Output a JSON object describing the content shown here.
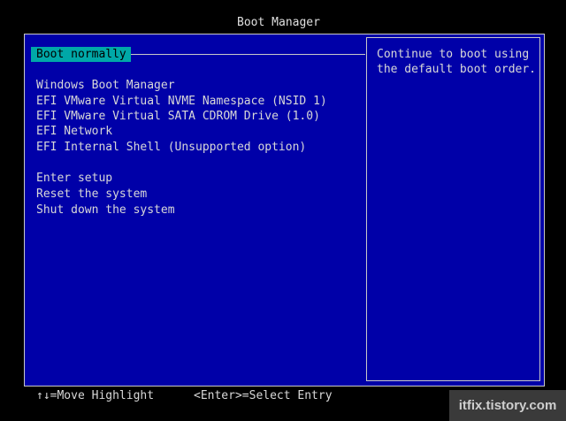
{
  "title": "Boot Manager",
  "menu": {
    "selected": "Boot normally",
    "boot_entries": [
      "Windows Boot Manager",
      "EFI VMware Virtual NVME Namespace (NSID 1)",
      "EFI VMware Virtual SATA CDROM Drive (1.0)",
      "EFI Network",
      "EFI Internal Shell (Unsupported option)"
    ],
    "actions": [
      "Enter setup",
      "Reset the system",
      "Shut down the system"
    ]
  },
  "help": {
    "text": "Continue to boot using\nthe default boot order."
  },
  "footer": {
    "move_hint": "↑↓=Move Highlight",
    "select_hint": "<Enter>=Select Entry"
  },
  "watermark": "itfix.tistory.com",
  "colors": {
    "background": "#000000",
    "panel": "#0000a8",
    "highlight": "#00a8a8",
    "text": "#d8d8d8",
    "border": "#c8c8c8"
  }
}
